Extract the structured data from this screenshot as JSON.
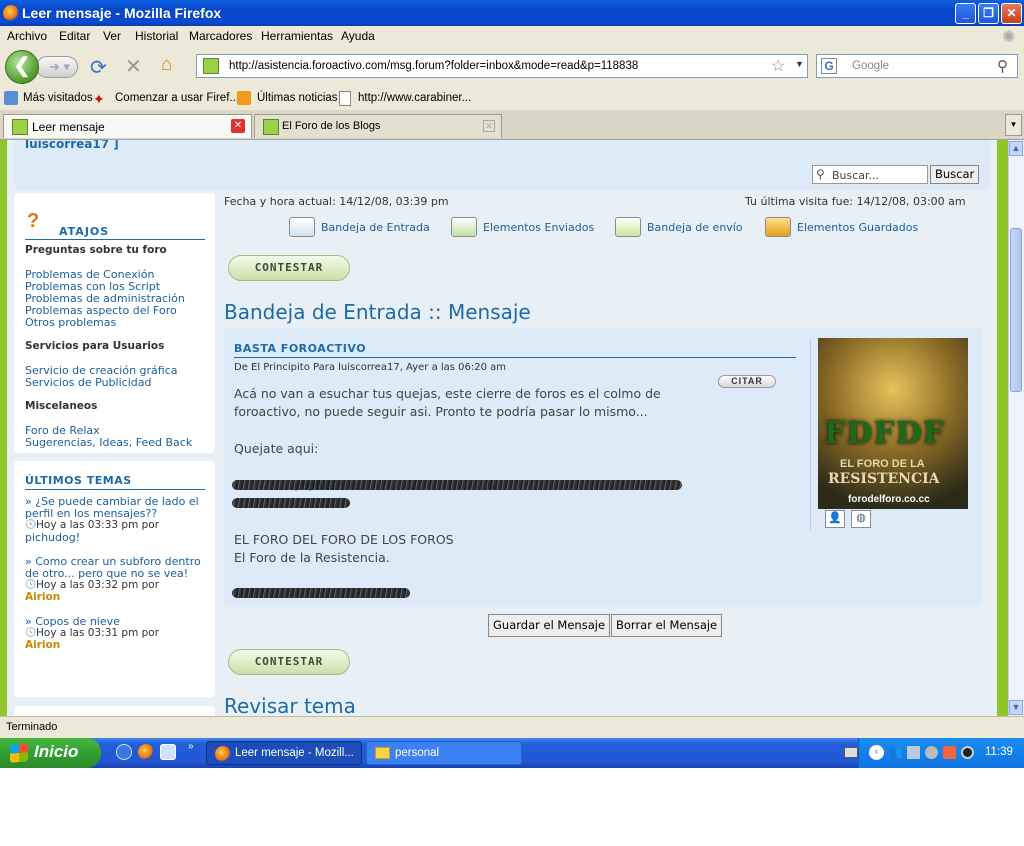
{
  "window": {
    "title": "Leer mensaje - Mozilla Firefox"
  },
  "menu": [
    "Archivo",
    "Editar",
    "Ver",
    "Historial",
    "Marcadores",
    "Herramientas",
    "Ayuda"
  ],
  "toolbar": {
    "url": "http://asistencia.foroactivo.com/msg.forum?folder=inbox&mode=read&p=118838",
    "search_placeholder": "Google"
  },
  "bookmarks": [
    "Más visitados",
    "Comenzar a usar Firef...",
    "Últimas noticias",
    "http://www.carabiner..."
  ],
  "tabs": [
    {
      "label": "Leer mensaje",
      "active": true
    },
    {
      "label": "El Foro de los Blogs",
      "active": false
    }
  ],
  "forum": {
    "username_line": "luiscorrea17 ]",
    "search_placeholder": "Buscar...",
    "search_button": "Buscar",
    "current_time": "Fecha y hora actual: 14/12/08, 03:39 pm",
    "last_visit": "Tu última visita fue: 14/12/08, 03:00 am",
    "folders": [
      "Bandeja de Entrada",
      "Elementos Enviados",
      "Bandeja de envío",
      "Elementos Guardados"
    ],
    "reply_button": "CONTESTAR",
    "page_heading": "Bandeja de Entrada :: Mensaje",
    "message": {
      "subject": "BASTA FOROACTIVO",
      "meta": "De El Principito Para luiscorrea17, Ayer a las 06:20 am",
      "quote_button": "CITAR",
      "line1": "Acá no van a esuchar tus quejas, este cierre de foros es el colmo de",
      "line2": "foroactivo, no puede seguir asi. Pronto te podría pasar lo mismo...",
      "line3": "Quejate aqui:",
      "link_fragment": "...phpBB2/vie.....................................&",
      "sig1": "EL FORO DEL FORO DE LOS FOROS",
      "sig2": "El Foro de la Resistencia.",
      "avatar_title": "FDFDF",
      "avatar_sub1": "EL FORO DE LA",
      "avatar_sub2": "RESISTENCIA",
      "avatar_url": "forodelforo.co.cc"
    },
    "save_button": "Guardar el Mensaje",
    "delete_button": "Borrar el Mensaje",
    "review_heading": "Revisar tema"
  },
  "sidebar": {
    "atajos_title": "ATAJOS",
    "section1": "Preguntas sobre tu foro",
    "links1": [
      "Problemas de Conexión",
      "Problemas con los Script",
      "Problemas de administración",
      "Problemas aspecto del Foro",
      "Otros problemas"
    ],
    "section2": "Servicios para Usuarios",
    "links2": [
      "Servicio de creación gráfica",
      "Servicios de Publicidad"
    ],
    "section3": "Miscelaneos",
    "links3": [
      "Foro de Relax",
      "Sugerencias, Ideas, Feed Back"
    ],
    "ultimos_title": "ÚLTIMOS TEMAS",
    "topics": [
      {
        "title_l1": "» ¿Se puede cambiar de lado el",
        "title_l2": "perfil en los mensajes??",
        "time": "Hoy a las 03:33 pm por",
        "user": "pichudog!"
      },
      {
        "title_l1": "» Como crear un subforo dentro",
        "title_l2": "de otro... pero que no se vea!",
        "time": "Hoy a las 03:32 pm por",
        "user": "Airion"
      },
      {
        "title_l1": "» Copos de nieve",
        "title_l2": "",
        "time": "Hoy a las 03:31 pm por",
        "user": "Airion"
      }
    ]
  },
  "status": "Terminado",
  "taskbar": {
    "start": "Inicio",
    "items": [
      "Leer mensaje - Mozill...",
      "personal"
    ],
    "clock": "11:39"
  }
}
